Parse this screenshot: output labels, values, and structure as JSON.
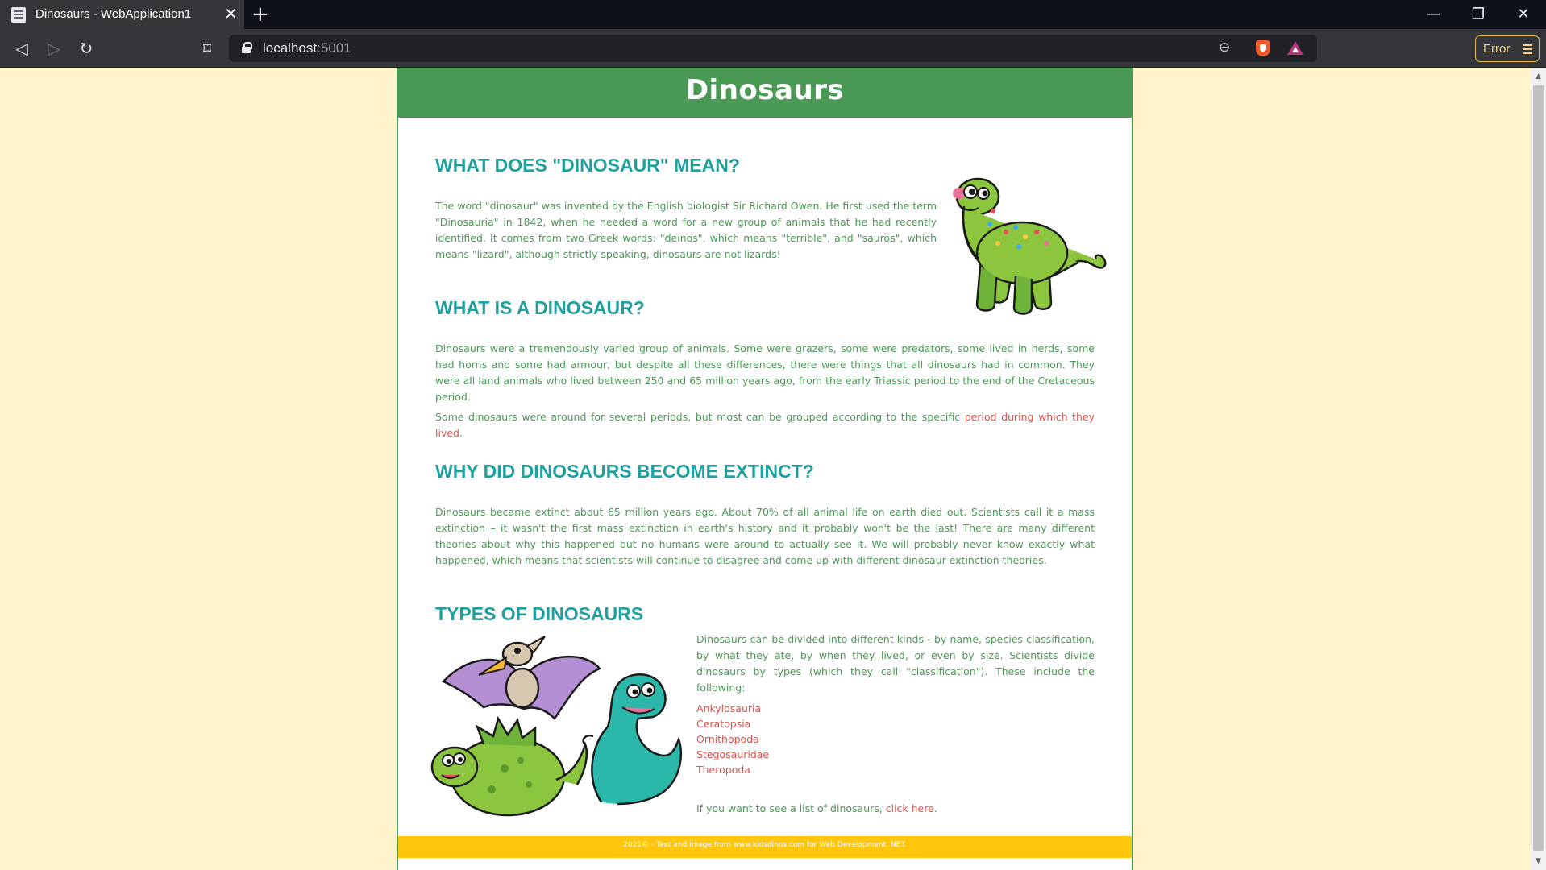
{
  "browser": {
    "tab_title": "Dinosaurs - WebApplication1",
    "tab_close": "✕",
    "new_tab": "+",
    "window": {
      "minimize": "—",
      "restore": "❐",
      "close": "✕"
    },
    "nav": {
      "back": "◁",
      "forward": "▷",
      "reload": "↻",
      "bookmark": "⌑"
    },
    "url_host": "localhost",
    "url_port": ":5001",
    "zoom_icon": "⊖",
    "error_label": "Error"
  },
  "page": {
    "title": "Dinosaurs",
    "sections": [
      {
        "heading": "WHAT DOES \"DINOSAUR\" MEAN?",
        "paragraph": "The word \"dinosaur\" was invented by the English biologist Sir Richard Owen. He first used the term \"Dinosauria\" in 1842, when he needed a word for a new group of animals that he had recently identified. It comes from two Greek words: \"deinos\", which means \"terrible\", and \"sauros\", which means \"lizard\", although strictly speaking, dinosaurs are not lizards!"
      },
      {
        "heading": "WHAT IS A DINOSAUR?",
        "paragraph": "Dinosaurs were a tremendously varied group of animals. Some were grazers, some were predators, some lived in herds, some had horns and some had armour, but despite all these differences, there were things that all dinosaurs had in common. They were all land animals who lived between 250 and 65 million years ago, from the early Triassic period to the end of the Cretaceous period.",
        "paragraph2_prefix": "Some dinosaurs were around for several periods, but most can be grouped according to the specific ",
        "paragraph2_link": "period during which they lived",
        "paragraph2_suffix": "."
      },
      {
        "heading": "WHY DID DINOSAURS BECOME EXTINCT?",
        "paragraph": "Dinosaurs became extinct about 65 million years ago. About 70% of all animal life on earth died out. Scientists call it a mass extinction – it wasn't the first mass extinction in earth's history and it probably won't be the last! There are many different theories about why this happened but no humans were around to actually see it. We will probably never know exactly what happened, which means that scientists will continue to disagree and come up with different dinosaur extinction theories."
      },
      {
        "heading": "TYPES OF DINOSAURS",
        "paragraph": "Dinosaurs can be divided into different kinds - by name, species classification, by what they ate, by when they lived, or even by size. Scientists divide dinosaurs by types (which they call \"classification\"). These include the following:",
        "types": [
          "Ankylosauria",
          "Ceratopsia",
          "Ornithopoda",
          "Stegosauridae",
          "Theropoda"
        ],
        "list_prefix": "If you want to see a list of dinosaurs, ",
        "list_link": "click here",
        "list_suffix": "."
      }
    ],
    "footer": "2021© - Text and image from www.kidsdinos.com for Web Development .NET."
  },
  "colors": {
    "header_green": "#4a9a55",
    "heading_teal": "#1e9fa0",
    "text_green": "#4a9a55",
    "link_red": "#e0504a",
    "footer_yellow": "#ffc60b",
    "page_background": "#fff4cc"
  },
  "icons": {
    "favicon": "page-icon",
    "back": "back-arrow-icon",
    "forward": "forward-arrow-icon",
    "reload": "reload-icon",
    "bookmark": "bookmark-icon",
    "lock": "lock-icon",
    "zoom": "zoom-out-icon",
    "brave_shield": "brave-shield-icon",
    "rewards": "brave-rewards-icon",
    "menu": "hamburger-menu-icon"
  }
}
